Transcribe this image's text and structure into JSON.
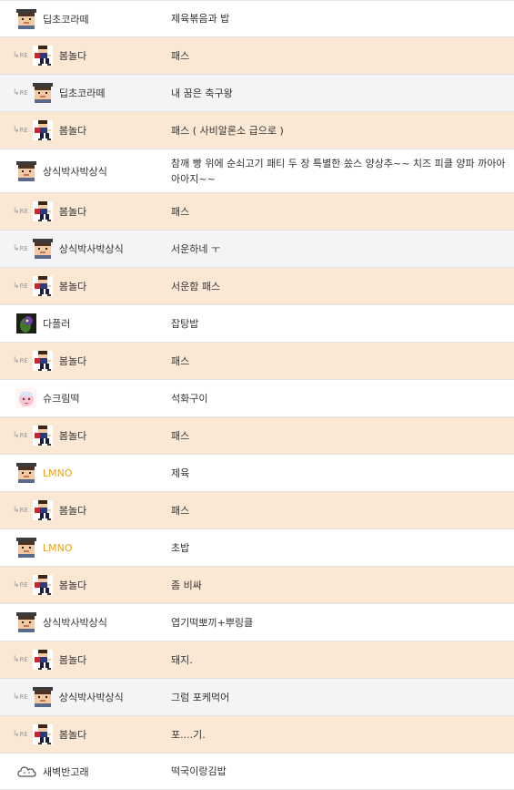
{
  "reply_marker": "RE",
  "rows": [
    {
      "type": "post",
      "nick": "딥초코라떼",
      "avatar": "pixel-student",
      "nick_color": "",
      "msg": "제육볶음과 밥"
    },
    {
      "type": "reply",
      "nick": "봄놀다",
      "avatar": "pixel-runner",
      "nick_color": "",
      "msg": "패스"
    },
    {
      "type": "reply-alt",
      "nick": "딥초코라떼",
      "avatar": "pixel-student",
      "nick_color": "",
      "msg": "내 꿈은 축구왕"
    },
    {
      "type": "reply",
      "nick": "봄놀다",
      "avatar": "pixel-runner",
      "nick_color": "",
      "msg": "패스 ( 사비알론소 급으로 )"
    },
    {
      "type": "post",
      "nick": "상식박사박상식",
      "avatar": "pixel-student",
      "nick_color": "",
      "msg": "참깨 빵 위에 순쇠고기 패티 두 장 특별한 쏬스 양상추~~ 치즈 피클 양파 까아아아아지~~"
    },
    {
      "type": "reply",
      "nick": "봄놀다",
      "avatar": "pixel-runner",
      "nick_color": "",
      "msg": "패스"
    },
    {
      "type": "reply-alt",
      "nick": "상식박사박상식",
      "avatar": "pixel-student",
      "nick_color": "",
      "msg": "서운하네 ㅜ"
    },
    {
      "type": "reply",
      "nick": "봄놀다",
      "avatar": "pixel-runner",
      "nick_color": "",
      "msg": "서운함 패스"
    },
    {
      "type": "post",
      "nick": "다플러",
      "avatar": "dark-creature",
      "nick_color": "",
      "msg": "잡탕밥"
    },
    {
      "type": "reply",
      "nick": "봄놀다",
      "avatar": "pixel-runner",
      "nick_color": "",
      "msg": "패스"
    },
    {
      "type": "post",
      "nick": "슈크림떡",
      "avatar": "pink-character",
      "nick_color": "",
      "msg": "석화구이"
    },
    {
      "type": "reply",
      "nick": "봄놀다",
      "avatar": "pixel-runner",
      "nick_color": "",
      "msg": "패스"
    },
    {
      "type": "post",
      "nick": "LMNO",
      "avatar": "pixel-student",
      "nick_color": "#e8a317",
      "msg": "제육"
    },
    {
      "type": "reply",
      "nick": "봄놀다",
      "avatar": "pixel-runner",
      "nick_color": "",
      "msg": "패스"
    },
    {
      "type": "post",
      "nick": "LMNO",
      "avatar": "pixel-student",
      "nick_color": "#e8a317",
      "msg": "초밥"
    },
    {
      "type": "reply",
      "nick": "봄놀다",
      "avatar": "pixel-runner",
      "nick_color": "",
      "msg": "좀 비싸"
    },
    {
      "type": "post",
      "nick": "상식박사박상식",
      "avatar": "pixel-student",
      "nick_color": "",
      "msg": "엽기떡뽀끼+뿌링클"
    },
    {
      "type": "reply",
      "nick": "봄놀다",
      "avatar": "pixel-runner",
      "nick_color": "",
      "msg": "돼지."
    },
    {
      "type": "reply-alt",
      "nick": "상식박사박상식",
      "avatar": "pixel-student",
      "nick_color": "",
      "msg": "그럼 포케먹어"
    },
    {
      "type": "reply",
      "nick": "봄놀다",
      "avatar": "pixel-runner",
      "nick_color": "",
      "msg": "포....기."
    },
    {
      "type": "post",
      "nick": "새벽반고래",
      "avatar": "cloud-outline",
      "nick_color": "",
      "msg": "떡국이랑김밥"
    }
  ]
}
